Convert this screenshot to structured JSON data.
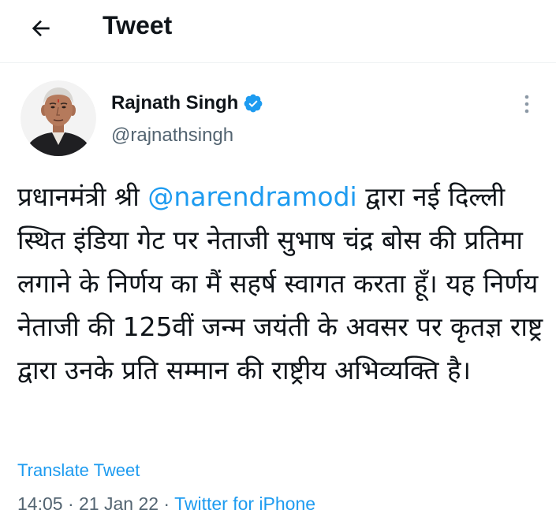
{
  "header": {
    "title": "Tweet",
    "back_icon": "arrow-left-icon"
  },
  "author": {
    "display_name": "Rajnath Singh",
    "handle": "@rajnathsingh",
    "verified_icon": "verified-badge-icon",
    "more_icon": "more-vertical-icon",
    "verified_color": "#1d9bf0"
  },
  "tweet": {
    "text_before": "प्रधानमंत्री श्री ",
    "mention": "@narendramodi",
    "text_after": " द्वारा नई दिल्ली स्थित इंडिया गेट पर नेताजी सुभाष चंद्र बोस की प्रतिमा लगाने के निर्णय का मैं सहर्ष स्वागत करता हूँ। यह निर्णय नेताजी की 125वीं जन्म जयंती के अवसर पर कृतज्ञ राष्ट्र द्वारा उनके प्रति सम्मान की राष्ट्रीय अभिव्यक्ति है।",
    "translate_label": "Translate Tweet"
  },
  "meta": {
    "time": "14:05",
    "separator": " · ",
    "date": "21 Jan 22",
    "source": "Twitter for iPhone"
  },
  "colors": {
    "accent": "#1d9bf0",
    "text": "#0f1419",
    "secondary": "#536471"
  }
}
